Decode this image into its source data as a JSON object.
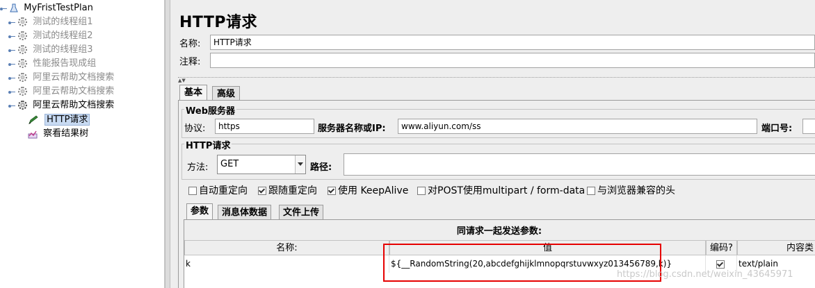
{
  "tree": {
    "items": [
      {
        "label": "MyFristTestPlan",
        "kind": "plan"
      },
      {
        "label": "测试的线程组1",
        "kind": "threadgroup"
      },
      {
        "label": "测试的线程组2",
        "kind": "threadgroup"
      },
      {
        "label": "测试的线程组3",
        "kind": "threadgroup"
      },
      {
        "label": "性能报告现成组",
        "kind": "threadgroup"
      },
      {
        "label": "阿里云帮助文档搜索",
        "kind": "threadgroup"
      },
      {
        "label": "阿里云帮助文档搜索",
        "kind": "threadgroup"
      },
      {
        "label": "阿里云帮助文档搜索",
        "kind": "threadgroup"
      },
      {
        "label": "HTTP请求",
        "kind": "sampler"
      },
      {
        "label": "察看结果树",
        "kind": "listener"
      }
    ]
  },
  "main": {
    "title": "HTTP请求",
    "name_label": "名称:",
    "name_value": "HTTP请求",
    "comment_label": "注释:",
    "comment_value": "",
    "tabs": [
      {
        "label": "基本"
      },
      {
        "label": "高级"
      }
    ]
  },
  "web_server": {
    "legend": "Web服务器",
    "protocol_label": "协议:",
    "protocol_value": "https",
    "server_label": "服务器名称或IP:",
    "server_value": "www.aliyun.com/ss",
    "port_label": "端口号:",
    "port_value": ""
  },
  "http_request": {
    "legend": "HTTP请求",
    "method_label": "方法:",
    "method_value": "GET",
    "path_label": "路径:",
    "path_value": ""
  },
  "options": [
    {
      "label": "自动重定向",
      "checked": false
    },
    {
      "label": "跟随重定向",
      "checked": true
    },
    {
      "label": "使用 KeepAlive",
      "checked": true
    },
    {
      "label": "对POST使用multipart / form-data",
      "checked": false
    },
    {
      "label": "与浏览器兼容的头",
      "checked": false
    }
  ],
  "subtabs": [
    {
      "label": "参数"
    },
    {
      "label": "消息体数据"
    },
    {
      "label": "文件上传"
    }
  ],
  "params": {
    "title": "同请求一起发送参数:",
    "columns": [
      "名称:",
      "值",
      "编码?",
      "内容类"
    ],
    "rows": [
      {
        "name": "k",
        "value": "${__RandomString(20,abcdefghijklmnopqrstuvwxyz013456789,k)}",
        "encode": true,
        "content_type": "text/plain"
      }
    ]
  },
  "watermark": "https://blog.csdn.net/weixin_43645971",
  "colors": {
    "highlight": "#e60000",
    "selection": "#c8daf2"
  }
}
